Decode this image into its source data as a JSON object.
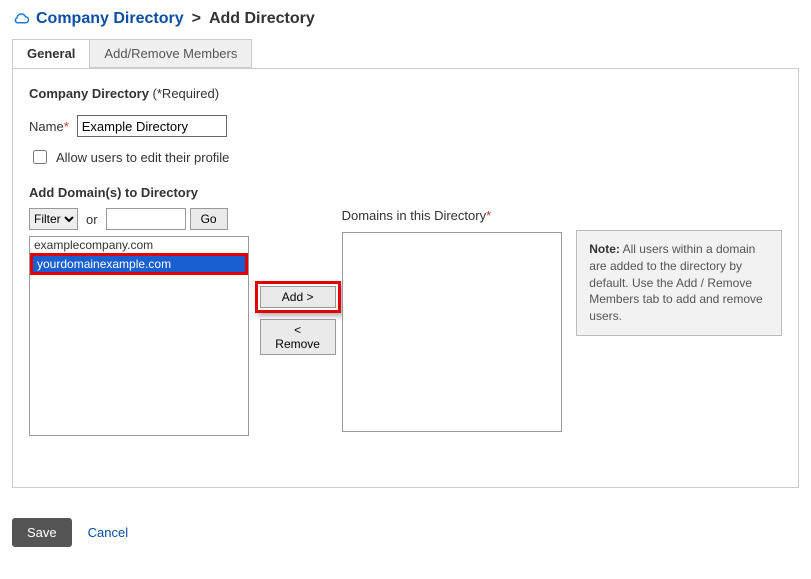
{
  "breadcrumb": {
    "root": "Company Directory",
    "current": "Add Directory"
  },
  "tabs": {
    "general": "General",
    "members": "Add/Remove Members"
  },
  "section": {
    "title": "Company Directory",
    "required_suffix": "(*Required)"
  },
  "name_field": {
    "label": "Name",
    "value": "Example Directory"
  },
  "allow_edit": {
    "label": "Allow users to edit their profile"
  },
  "add_domains_title": "Add Domain(s) to Directory",
  "filter": {
    "select_label": "Filter",
    "or": "or",
    "go": "Go"
  },
  "available_domains": [
    {
      "text": "examplecompany.com",
      "selected": false
    },
    {
      "text": "yourdomainexample.com",
      "selected": true
    }
  ],
  "mid": {
    "add": "Add >",
    "remove": "< Remove"
  },
  "right": {
    "title": "Domains in this Directory"
  },
  "note": {
    "heading": "Note:",
    "body": "All users within a domain are added to the directory by default. Use the Add / Remove Members tab to add and remove users."
  },
  "footer": {
    "save": "Save",
    "cancel": "Cancel"
  }
}
